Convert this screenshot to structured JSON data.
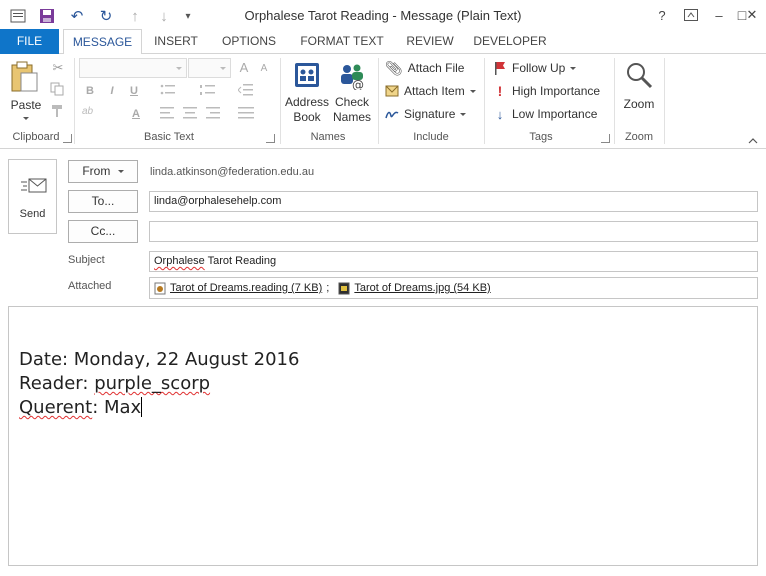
{
  "window": {
    "title": "Orphalese Tarot Reading - Message (Plain Text)",
    "help": "?",
    "restore_ribbon": "⧉",
    "minimize": "–",
    "maximize": "□",
    "close": "✕"
  },
  "quick_access": {
    "save": "💾",
    "undo": "↶",
    "redo": "↻",
    "up": "↑",
    "down": "↓",
    "customize": "▾"
  },
  "tabs": [
    "FILE",
    "MESSAGE",
    "INSERT",
    "OPTIONS",
    "FORMAT TEXT",
    "REVIEW",
    "DEVELOPER"
  ],
  "ribbon": {
    "clipboard": {
      "label": "Clipboard",
      "paste": "Paste"
    },
    "basic_text": {
      "label": "Basic Text",
      "bold": "B",
      "italic": "I",
      "underline": "U",
      "grow": "A",
      "shrink": "A",
      "font_color": "A"
    },
    "names": {
      "label": "Names",
      "address_book": [
        "Address",
        "Book"
      ],
      "check_names": [
        "Check",
        "Names"
      ]
    },
    "include": {
      "label": "Include",
      "attach_file": "Attach File",
      "attach_item": "Attach Item",
      "signature": "Signature"
    },
    "tags": {
      "label": "Tags",
      "follow_up": "Follow Up",
      "high_importance": "High Importance",
      "low_importance": "Low Importance"
    },
    "zoom": {
      "label": "Zoom",
      "zoom": "Zoom"
    }
  },
  "header": {
    "send": "Send",
    "from_button": "From",
    "from_value": "linda.atkinson@federation.edu.au",
    "to_button": "To...",
    "to_value": "linda@orphalesehelp.com",
    "cc_button": "Cc...",
    "cc_value": "",
    "subject_label": "Subject",
    "subject_value_1": "Orphalese",
    "subject_value_2": " Tarot Reading",
    "attached_label": "Attached",
    "attachments": [
      {
        "name": "Tarot of Dreams.reading (7 KB)",
        "sep": ";"
      },
      {
        "name": "Tarot of Dreams.jpg (54 KB)",
        "sep": ""
      }
    ]
  },
  "body": {
    "line1": "Date: Monday, 22 August 2016",
    "line2_prefix": "Reader: ",
    "line2_name": "purple_scorp",
    "line3_prefix": "Querent",
    "line3_rest": ": Max"
  },
  "colors": {
    "accent": "#2b579a",
    "file_tab": "#0f75c9",
    "follow_up_flag": "#d13438",
    "high_importance": "#d13438",
    "low_importance": "#2b579a"
  }
}
